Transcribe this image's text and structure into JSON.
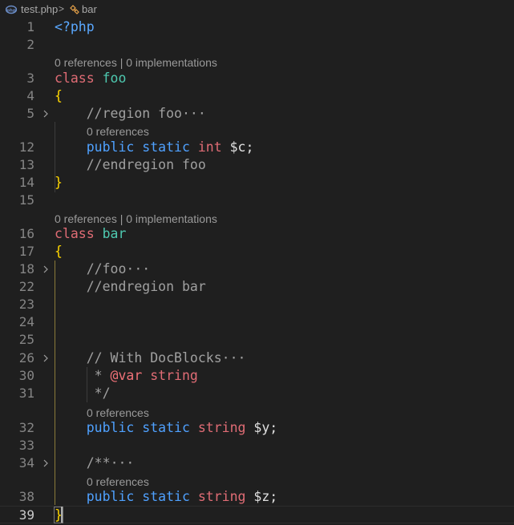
{
  "breadcrumb": {
    "file": "test.php",
    "separator": ">",
    "symbol": "bar"
  },
  "lens": {
    "class_foo": "0 references | 0 implementations",
    "prop_c": "0 references",
    "class_bar": "0 references | 0 implementations",
    "prop_y": "0 references",
    "prop_z": "0 references"
  },
  "lines": [
    {
      "n": "1",
      "tokens": [
        [
          "<?php",
          "tag"
        ]
      ]
    },
    {
      "n": "2",
      "tokens": []
    },
    {
      "n": "3",
      "tokens": [
        [
          "class",
          "kwc"
        ],
        [
          " ",
          ""
        ],
        [
          "foo",
          "name"
        ]
      ]
    },
    {
      "n": "4",
      "tokens": [
        [
          "{",
          "brace"
        ]
      ]
    },
    {
      "n": "5",
      "tokens": [
        [
          "    ",
          ""
        ],
        [
          "//region foo",
          "cmt"
        ],
        [
          "···",
          "ellip"
        ]
      ],
      "fold": true
    },
    {
      "n": "12",
      "tokens": [
        [
          "    ",
          ""
        ],
        [
          "public",
          "blue"
        ],
        [
          " ",
          ""
        ],
        [
          "static",
          "blue"
        ],
        [
          " ",
          ""
        ],
        [
          "int",
          "kwc"
        ],
        [
          " ",
          ""
        ],
        [
          "$c;",
          "var"
        ]
      ]
    },
    {
      "n": "13",
      "tokens": [
        [
          "    ",
          ""
        ],
        [
          "//endregion foo",
          "cmt"
        ]
      ]
    },
    {
      "n": "14",
      "tokens": [
        [
          "}",
          "brace"
        ]
      ]
    },
    {
      "n": "15",
      "tokens": []
    },
    {
      "n": "16",
      "tokens": [
        [
          "class",
          "kwc"
        ],
        [
          " ",
          ""
        ],
        [
          "bar",
          "name"
        ]
      ]
    },
    {
      "n": "17",
      "tokens": [
        [
          "{",
          "brace"
        ]
      ]
    },
    {
      "n": "18",
      "tokens": [
        [
          "    ",
          ""
        ],
        [
          "//foo",
          "cmt"
        ],
        [
          "···",
          "ellip"
        ]
      ],
      "fold": true
    },
    {
      "n": "22",
      "tokens": [
        [
          "    ",
          ""
        ],
        [
          "//endregion bar",
          "cmt"
        ]
      ]
    },
    {
      "n": "23",
      "tokens": []
    },
    {
      "n": "24",
      "tokens": []
    },
    {
      "n": "25",
      "tokens": []
    },
    {
      "n": "26",
      "tokens": [
        [
          "    ",
          ""
        ],
        [
          "// With DocBlocks",
          "cmt"
        ],
        [
          "···",
          "ellip"
        ]
      ],
      "fold": true
    },
    {
      "n": "30",
      "tokens": [
        [
          "     ",
          ""
        ],
        [
          "* ",
          "cmt"
        ],
        [
          "@var",
          "doctag"
        ],
        [
          " ",
          ""
        ],
        [
          "string",
          "kwc"
        ]
      ]
    },
    {
      "n": "31",
      "tokens": [
        [
          "     ",
          ""
        ],
        [
          "*/",
          "cmt"
        ]
      ]
    },
    {
      "n": "32",
      "tokens": [
        [
          "    ",
          ""
        ],
        [
          "public",
          "blue"
        ],
        [
          " ",
          ""
        ],
        [
          "static",
          "blue"
        ],
        [
          " ",
          ""
        ],
        [
          "string",
          "kwc"
        ],
        [
          " ",
          ""
        ],
        [
          "$y;",
          "var"
        ]
      ]
    },
    {
      "n": "33",
      "tokens": []
    },
    {
      "n": "34",
      "tokens": [
        [
          "    ",
          ""
        ],
        [
          "/**",
          "cmt"
        ],
        [
          "···",
          "ellip"
        ]
      ],
      "fold": true
    },
    {
      "n": "38",
      "tokens": [
        [
          "    ",
          ""
        ],
        [
          "public",
          "blue"
        ],
        [
          " ",
          ""
        ],
        [
          "static",
          "blue"
        ],
        [
          " ",
          ""
        ],
        [
          "string",
          "kwc"
        ],
        [
          " ",
          ""
        ],
        [
          "$z;",
          "var"
        ]
      ]
    },
    {
      "n": "39",
      "tokens": [
        [
          "}",
          "brace"
        ]
      ],
      "active": true
    }
  ],
  "colors": {
    "background": "#1f1f1f",
    "tag": "#5aa8ff",
    "keyword": "#e06c75",
    "storage": "#4fa1ff",
    "class_name": "#4ec9b0",
    "brace": "#ffd700",
    "comment": "#a0a0a0"
  }
}
